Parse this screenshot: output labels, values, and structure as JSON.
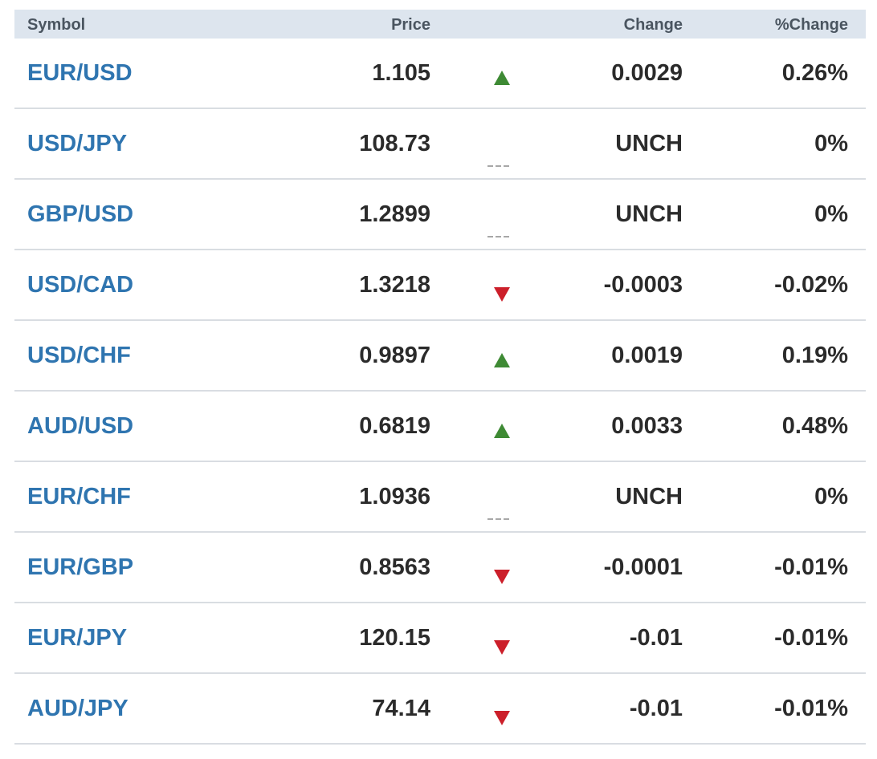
{
  "columns": {
    "symbol": "Symbol",
    "price": "Price",
    "change": "Change",
    "pct_change": "%Change"
  },
  "colors": {
    "link": "#2f75b0",
    "up": "#3e8a34",
    "down": "#cc1f2a",
    "header_bg": "#dde5ee"
  },
  "rows": [
    {
      "symbol": "EUR/USD",
      "price": "1.105",
      "direction": "up",
      "change": "0.0029",
      "pct_change": "0.26%"
    },
    {
      "symbol": "USD/JPY",
      "price": "108.73",
      "direction": "unch",
      "change": "UNCH",
      "pct_change": "0%"
    },
    {
      "symbol": "GBP/USD",
      "price": "1.2899",
      "direction": "unch",
      "change": "UNCH",
      "pct_change": "0%"
    },
    {
      "symbol": "USD/CAD",
      "price": "1.3218",
      "direction": "down",
      "change": "-0.0003",
      "pct_change": "-0.02%"
    },
    {
      "symbol": "USD/CHF",
      "price": "0.9897",
      "direction": "up",
      "change": "0.0019",
      "pct_change": "0.19%"
    },
    {
      "symbol": "AUD/USD",
      "price": "0.6819",
      "direction": "up",
      "change": "0.0033",
      "pct_change": "0.48%"
    },
    {
      "symbol": "EUR/CHF",
      "price": "1.0936",
      "direction": "unch",
      "change": "UNCH",
      "pct_change": "0%"
    },
    {
      "symbol": "EUR/GBP",
      "price": "0.8563",
      "direction": "down",
      "change": "-0.0001",
      "pct_change": "-0.01%"
    },
    {
      "symbol": "EUR/JPY",
      "price": "120.15",
      "direction": "down",
      "change": "-0.01",
      "pct_change": "-0.01%"
    },
    {
      "symbol": "AUD/JPY",
      "price": "74.14",
      "direction": "down",
      "change": "-0.01",
      "pct_change": "-0.01%"
    }
  ]
}
